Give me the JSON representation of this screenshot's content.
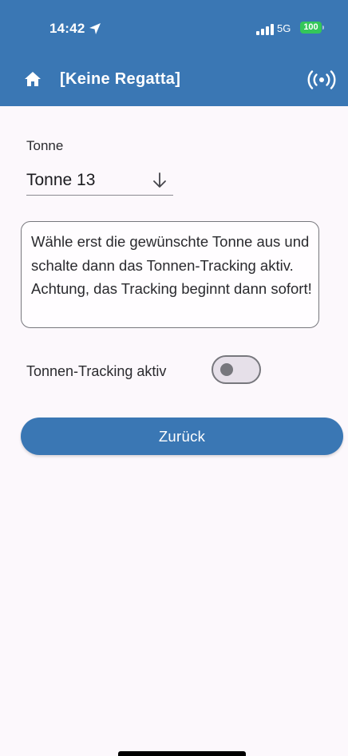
{
  "status_bar": {
    "time": "14:42",
    "network": "5G",
    "battery": "100"
  },
  "toolbar": {
    "title": "[Keine Regatta]"
  },
  "form": {
    "buoy_label": "Tonne",
    "buoy_value": "Tonne 13",
    "info_text": "Wähle erst die gewünschte Tonne aus und schalte dann das Tonnen-Tracking aktiv. Achtung, das Tracking beginnt dann sofort!",
    "tracking_label": "Tonnen-Tracking aktiv",
    "tracking_active": false,
    "back_label": "Zurück"
  },
  "icons": {
    "home": "home-icon",
    "broadcast": "broadcast-icon",
    "dropdown": "arrow-down-icon",
    "location": "location-arrow-icon",
    "signal": "cellular-signal-icon"
  },
  "colors": {
    "primary": "#3a77b4",
    "battery": "#34c759"
  }
}
